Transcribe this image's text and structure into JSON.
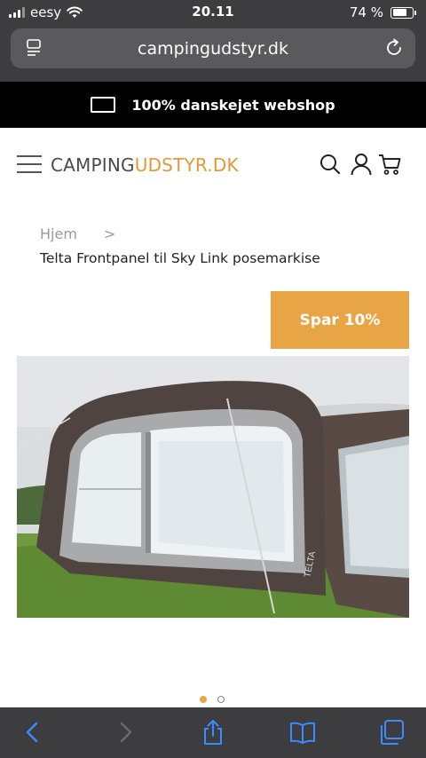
{
  "status_bar": {
    "carrier": "eesy",
    "time": "20.11",
    "battery": "74 %",
    "battery_level": 0.74
  },
  "browser": {
    "url": "campingudstyr.dk",
    "icons": [
      "reader-icon",
      "reload-icon"
    ]
  },
  "banner": {
    "text": "100% danskejet webshop",
    "icon": "laptop-icon"
  },
  "header": {
    "logo_part1": "CAMPING",
    "logo_part2": "UDSTYR.DK",
    "icons": [
      "hamburger-menu-icon",
      "search-icon",
      "account-icon",
      "cart-icon"
    ],
    "accent_color": "#e09a35"
  },
  "breadcrumb": {
    "home": "Hjem",
    "separator": ">",
    "current": "Telta Frontpanel til Sky Link posemarkise"
  },
  "product": {
    "badge": "Spar 10%",
    "badge_color": "#e8a545",
    "image_alt": "Telta awning on grass",
    "brand_mark": "TELTA",
    "carousel_total": 2,
    "carousel_active": 1
  },
  "toolbar": {
    "icons": [
      "back-icon",
      "forward-icon",
      "share-icon",
      "bookmarks-icon",
      "tabs-icon"
    ],
    "icon_color": "#3b8cff"
  }
}
